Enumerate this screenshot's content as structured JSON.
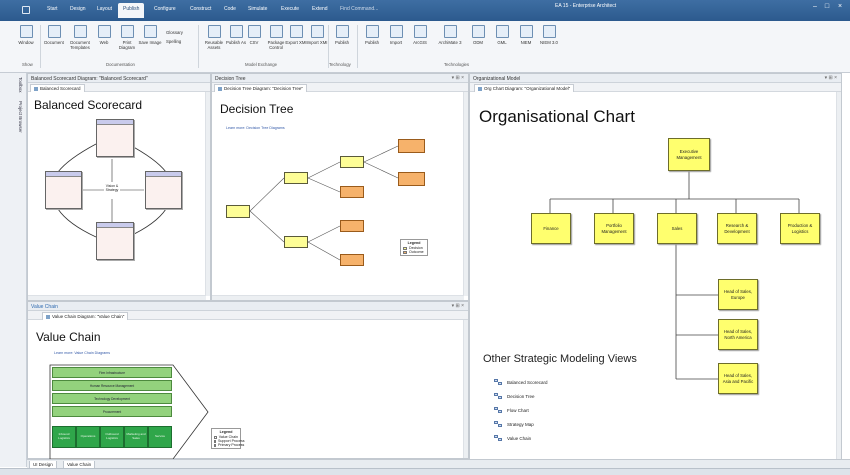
{
  "app": {
    "title": "EA 15 - Enterprise Architect",
    "find_placeholder": "Find Command..."
  },
  "menu_tabs": [
    "Start",
    "Design",
    "Layout",
    "Publish",
    "Configure",
    "Construct",
    "Code",
    "Simulate",
    "Execute",
    "Extend"
  ],
  "ribbon": {
    "buttons": [
      {
        "label": "Window"
      },
      {
        "label": "Document"
      },
      {
        "label": "Document Templates"
      },
      {
        "label": "Web"
      },
      {
        "label": "Print Diagram"
      },
      {
        "label": "Save Image"
      },
      {
        "label": "Reusable Assets"
      },
      {
        "label": "Publish As"
      },
      {
        "label": "CSV"
      },
      {
        "label": "Package Control"
      },
      {
        "label": "Export XMI"
      },
      {
        "label": "Import XMI"
      },
      {
        "label": "Publish"
      },
      {
        "label": "Publish"
      },
      {
        "label": "Import"
      },
      {
        "label": "ArcGIS"
      },
      {
        "label": "ArchiMate 3"
      },
      {
        "label": "ODM"
      },
      {
        "label": "GML"
      },
      {
        "label": "NIEM"
      },
      {
        "label": "NIEM 3.0"
      }
    ],
    "small_items": [
      "Glossary",
      "Spelling"
    ],
    "groups": [
      "Show",
      "Documentation",
      "Model Exchange",
      "Technology",
      "Technologies"
    ]
  },
  "side_tabs": [
    "Toolbox",
    "Project Browser"
  ],
  "panes": {
    "balanced": {
      "header": "Balanced Scorecard Diagram: \"Balanced Scorecard\"",
      "tab": "Balanced Scorecard",
      "title": "Balanced Scorecard",
      "center_text": "Vision & Strategy"
    },
    "decision": {
      "header": "Decision Tree",
      "tab": "Decision Tree Diagram: \"Decision Tree\"",
      "title": "Decision Tree",
      "link": "Learn more: Decision Tree Diagrams",
      "legend_title": "Legend",
      "legend_items": [
        "Decision",
        "Outcome"
      ]
    },
    "org": {
      "header": "Organizational Model",
      "tab": "Org Chart Diagram: \"Organizational Model\"",
      "title": "Organisational Chart",
      "root": "Executive Management",
      "level1": [
        "Finance",
        "Portfolio Management",
        "Sales",
        "Research & Development",
        "Production & Logistics"
      ],
      "sales_children": [
        "Head of Sales, Europe",
        "Head of Sales, North America",
        "Head of Sales, Asia and Pacific"
      ],
      "views_title": "Other Strategic Modeling Views",
      "views": [
        "Balanced Scorecard",
        "Decision Tree",
        "Flow Chart",
        "Strategy Map",
        "Value Chain"
      ]
    },
    "value": {
      "header": "Value Chain",
      "tab": "Value Chain Diagram: \"Value Chain\"",
      "title": "Value Chain",
      "link": "Learn more: Value Chain Diagrams",
      "rows": [
        "Firm Infrastructure",
        "Human Resource Management",
        "Technology Development",
        "Procurement"
      ],
      "activities": [
        "Inbound Logistics",
        "Operations",
        "Outbound Logistics",
        "Marketing and Sales",
        "Service"
      ],
      "legend_title": "Legend",
      "legend_items": [
        "Value Chain",
        "Support Process",
        "Primary Process"
      ]
    }
  },
  "bottom_tabs": [
    "UI Design",
    "Value Chain"
  ],
  "colors": {
    "accent": "#2c5a8e",
    "note_yellow": "#ffff6e",
    "outcome_orange": "#f6b26b",
    "chain_green": "#2fa64a"
  }
}
